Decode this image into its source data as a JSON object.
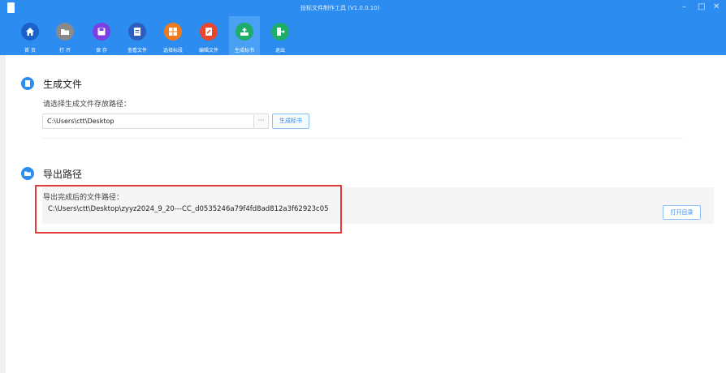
{
  "window": {
    "title": "投标文件制作工具 (V1.0.0.10)",
    "controls": {
      "minimize": "–",
      "maximize": "□",
      "close": "✕"
    }
  },
  "toolbar": {
    "items": [
      {
        "label": "首 页",
        "icon": "home-icon",
        "color": "#1a62c7"
      },
      {
        "label": "打 开",
        "icon": "folder-icon",
        "color": "#8a8a8a"
      },
      {
        "label": "保 存",
        "icon": "save-icon",
        "color": "#7b3fe4"
      },
      {
        "label": "查看文件",
        "icon": "document-icon",
        "color": "#2d5fbf"
      },
      {
        "label": "选择标段",
        "icon": "grid-icon",
        "color": "#f07b1d"
      },
      {
        "label": "编辑文件",
        "icon": "edit-icon",
        "color": "#e8462f"
      },
      {
        "label": "生成标书",
        "icon": "export-icon",
        "color": "#1fae6a",
        "active": true
      },
      {
        "label": "退出",
        "icon": "exit-icon",
        "color": "#1fae6a"
      }
    ]
  },
  "generate": {
    "title": "生成文件",
    "hint": "请选择生成文件存放路径：",
    "path_value": "C:\\Users\\ctt\\Desktop",
    "browse_label": "···",
    "button_label": "生成标书"
  },
  "export": {
    "title": "导出路径",
    "hint": "导出完成后的文件路径：",
    "path_value": "C:\\Users\\ctt\\Desktop\\zyyz2024_9_20---CC_d0535246a79f4fd8ad812a3f62923c05",
    "open_label": "打开目录"
  },
  "colors": {
    "accent": "#2d8cf0",
    "highlight": "#e03a3a"
  }
}
